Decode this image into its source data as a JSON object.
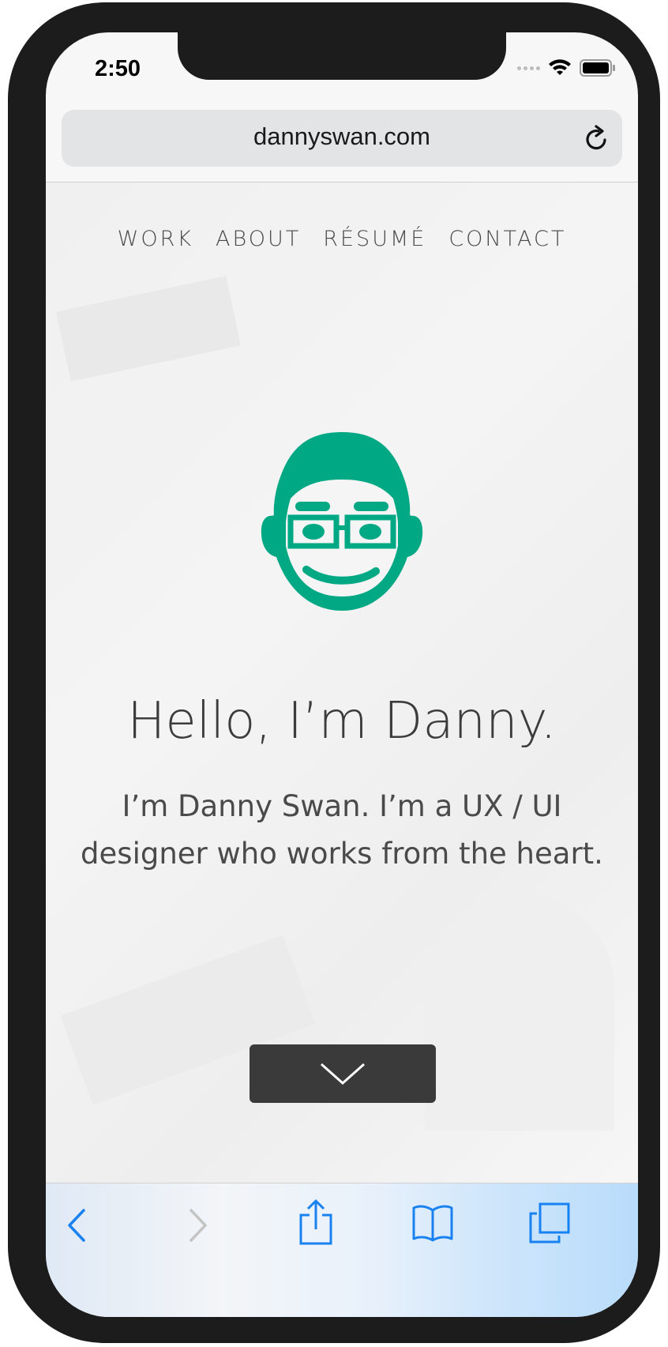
{
  "status": {
    "time": "2:50"
  },
  "browser": {
    "url": "dannyswan.com"
  },
  "nav": {
    "items": [
      "WORK",
      "ABOUT",
      "RÉSUMÉ",
      "CONTACT"
    ]
  },
  "hero": {
    "title": "Hello, I’m Danny.",
    "subtitle": "I’m Danny Swan. I’m a UX / UI designer who works from the heart."
  },
  "colors": {
    "accent": "#00a884",
    "toolbar_blue": "#1a82f0",
    "button_dark": "#3a3a3a"
  },
  "toolbar": {
    "icons": [
      "back-icon",
      "forward-icon",
      "share-icon",
      "bookmarks-icon",
      "tabs-icon"
    ]
  }
}
